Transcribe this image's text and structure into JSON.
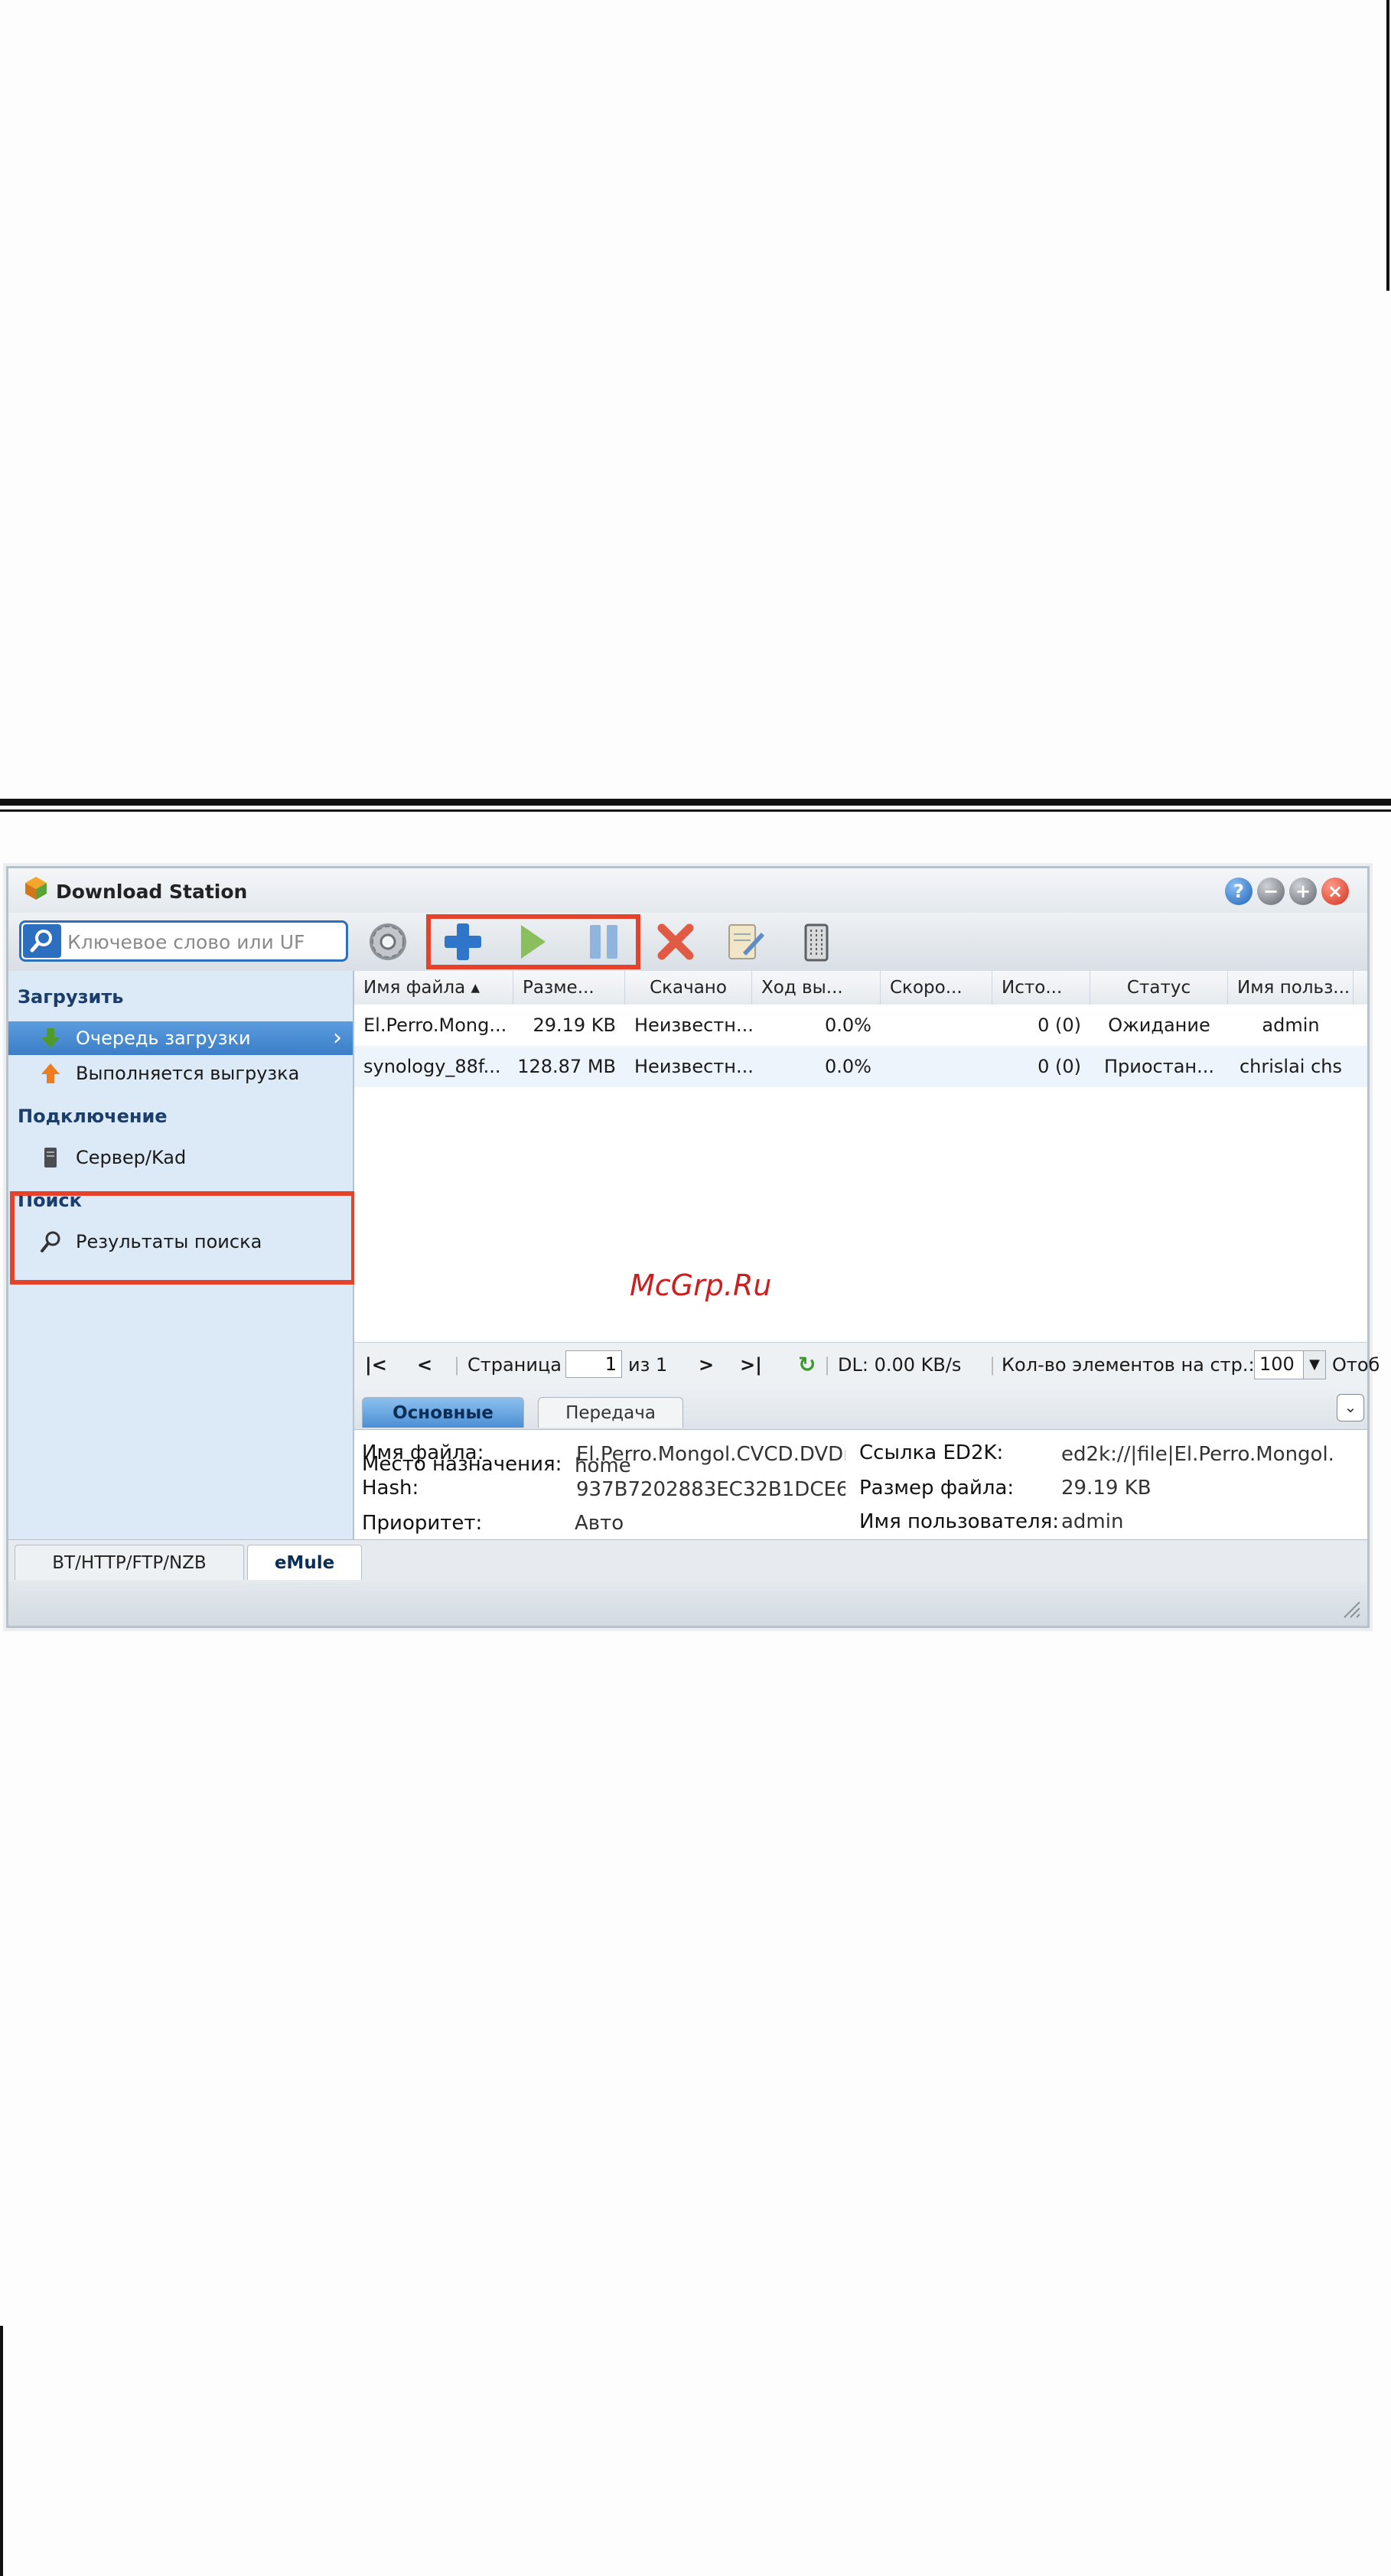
{
  "app": {
    "title": "Download Station",
    "accent": "#2c6fc0",
    "highlight": "#e8412a"
  },
  "window_controls": [
    "help-icon",
    "minimize-icon",
    "maximize-icon",
    "close-icon"
  ],
  "search": {
    "placeholder": "Ключевое слово или UF"
  },
  "toolbar": {
    "buttons": [
      "settings-icon",
      "add-icon",
      "resume-icon",
      "pause-icon",
      "delete-icon",
      "edit-icon",
      "clear-icon"
    ]
  },
  "sidebar": {
    "sections": [
      {
        "title": "Загрузить",
        "items": [
          {
            "label": "Очередь загрузки",
            "icon": "download-arrow-icon",
            "selected": true
          },
          {
            "label": "Выполняется выгрузка",
            "icon": "upload-arrow-icon"
          }
        ]
      },
      {
        "title": "Подключение",
        "items": [
          {
            "label": "Сервер/Kad",
            "icon": "server-icon"
          }
        ]
      },
      {
        "title": "Поиск",
        "items": [
          {
            "label": "Результаты поиска",
            "icon": "search-icon"
          }
        ]
      }
    ]
  },
  "table": {
    "columns": [
      "Имя файла",
      "Разме...",
      "Скачано",
      "Ход вы...",
      "Скоро...",
      "Исто...",
      "Статус",
      "Имя польз..."
    ],
    "rows": [
      [
        "El.Perro.Mong...",
        "29.19 KB",
        "Неизвестн...",
        "0.0%",
        "",
        "0 (0)",
        "Ожидание",
        "admin"
      ],
      [
        "synology_88f...",
        "128.87 MB",
        "Неизвестн...",
        "0.0%",
        "",
        "0 (0)",
        "Приостан...",
        "chrislai chs"
      ]
    ]
  },
  "pager": {
    "page_label": "Страница",
    "page": "1",
    "of": "из 1",
    "dl": "DL: 0.00 KB/s",
    "per_page_label": "Кол-во элементов на стр.:",
    "per_page": "100",
    "tail": "Отоб"
  },
  "watermark": "McGrp.Ru",
  "details": {
    "tabs": [
      "Основные",
      "Передача"
    ],
    "left": [
      {
        "label": "Имя файла:",
        "value": "El.Perro.Mongol.CVCD.DVDı"
      },
      {
        "label": "Hash:",
        "value": "937B7202883EC32B1DCE6"
      },
      {
        "label": "Приоритет:",
        "value": "Авто"
      },
      {
        "label": "Место назначения:",
        "value": "home"
      }
    ],
    "right": [
      {
        "label": "Ссылка ED2K:",
        "value": "ed2k://|file|El.Perro.Mongol."
      },
      {
        "label": "Размер файла:",
        "value": "29.19 KB"
      },
      {
        "label": "Имя пользователя:",
        "value": "admin"
      }
    ]
  },
  "bottom_tabs": [
    "BT/HTTP/FTP/NZB",
    "eMule"
  ]
}
